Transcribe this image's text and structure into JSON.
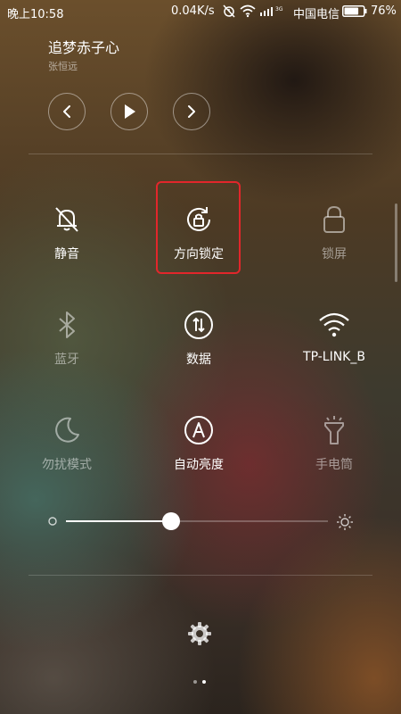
{
  "status_bar": {
    "time": "晚上10:58",
    "net_speed": "0.04K/s",
    "carrier": "中国电信",
    "battery_percent": "76%",
    "battery_level": 0.76,
    "signal_tech": "3G",
    "icons": [
      "alarm-off-icon",
      "wifi-icon",
      "signal-icon",
      "battery-icon"
    ]
  },
  "media": {
    "song_title": "追梦赤子心",
    "artist": "张恒远",
    "controls": [
      "previous-icon",
      "play-icon",
      "next-icon"
    ]
  },
  "toggles": [
    {
      "id": "mute",
      "label": "静音",
      "icon": "bell-off-icon",
      "state": "on"
    },
    {
      "id": "rotation-lock",
      "label": "方向锁定",
      "icon": "rotation-lock-icon",
      "state": "on",
      "highlighted": true
    },
    {
      "id": "lock-screen",
      "label": "锁屏",
      "icon": "lock-icon",
      "state": "off"
    },
    {
      "id": "bluetooth",
      "label": "蓝牙",
      "icon": "bluetooth-icon",
      "state": "off"
    },
    {
      "id": "data",
      "label": "数据",
      "icon": "data-arrows-icon",
      "state": "on"
    },
    {
      "id": "wifi",
      "label": "TP-LINK_B",
      "icon": "wifi-icon",
      "state": "on"
    },
    {
      "id": "dnd",
      "label": "勿扰模式",
      "icon": "moon-icon",
      "state": "off"
    },
    {
      "id": "auto-brightness",
      "label": "自动亮度",
      "icon": "auto-a-icon",
      "state": "on"
    },
    {
      "id": "flashlight",
      "label": "手电筒",
      "icon": "flashlight-icon",
      "state": "off"
    }
  ],
  "brightness": {
    "level": 0.4,
    "min_icon": "brightness-low-icon",
    "max_icon": "brightness-high-icon"
  },
  "settings": {
    "icon": "gear-icon"
  },
  "pager": {
    "pages": 2,
    "active": 1
  },
  "colors": {
    "highlight": "#e2262b"
  }
}
